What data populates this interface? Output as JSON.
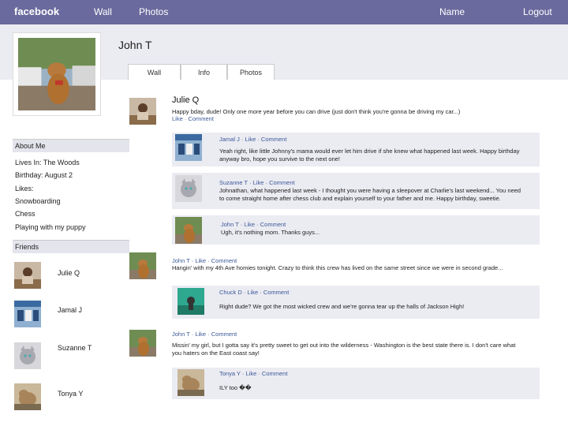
{
  "topbar": {
    "brand": "facebook",
    "wall": "Wall",
    "photos": "Photos",
    "name": "Name",
    "logout": "Logout"
  },
  "profile": {
    "name": "John T"
  },
  "tabs": {
    "wall": "Wall",
    "info": "Info",
    "photos": "Photos"
  },
  "about": {
    "heading": "About Me",
    "lives_in": "Lives In: The Woods",
    "birthday": "Birthday: August 2",
    "likes_label": "Likes:",
    "likes": [
      "Snowboarding",
      "Chess",
      "Playing with my puppy"
    ]
  },
  "friends": {
    "heading": "Friends",
    "list": [
      "Julie Q",
      "Jamal J",
      "Suzanne T",
      "Tonya Y"
    ]
  },
  "wall": {
    "post1": {
      "author": "Julie Q",
      "text": "Happy bday, dude! Only one more year before you can drive (just don't think you're gonna be driving my car...)",
      "meta": "Like · Comment"
    },
    "c1": {
      "meta": "Jamal J · Like · Comment",
      "text1": "Yeah right, like little Johnny's mama would ever let him drive if she knew what happened last week. Happy birthday",
      "text2": "anyway bro, hope you survive to the next one!"
    },
    "c2": {
      "meta": "Suzanne T · Like · Comment",
      "text1": "Johnathan, what happened last week - I thought you were having a sleepover at Charlie's last weekend... You need",
      "text2": "to come straight home after chess club and explain yourself to your father and me. Happy birthday, sweetie."
    },
    "c3": {
      "meta": "John T · Like · Comment",
      "text1": "Ugh, it's nothing mom. Thanks guys..."
    },
    "post2": {
      "meta": "John T · Like · Comment",
      "text": "Hangin' with my 4th Ave homies tonight. Crazy to think this crew has lived on the same street since we were in second grade..."
    },
    "c4": {
      "meta": "Chuck D · Like · Comment",
      "text1": "Right dude? We got the most wicked crew and we're gonna tear up the halls of Jackson High!"
    },
    "post3": {
      "meta": "John T · Like · Comment",
      "text1": "Missin' my girl, but I gotta say it's pretty sweet to get out into the wilderness - Washington is the best state there is. I don't care what",
      "text2": "you haters on the East coast say!"
    },
    "c5": {
      "meta": "Tonya Y · Like · Comment",
      "text1": "ILY too ��"
    }
  },
  "colors": {
    "topbar": "#6a6a9e",
    "band": "#ebebf2",
    "link": "#3b5998"
  },
  "icons": {
    "photo": "photo-thumbnail"
  }
}
